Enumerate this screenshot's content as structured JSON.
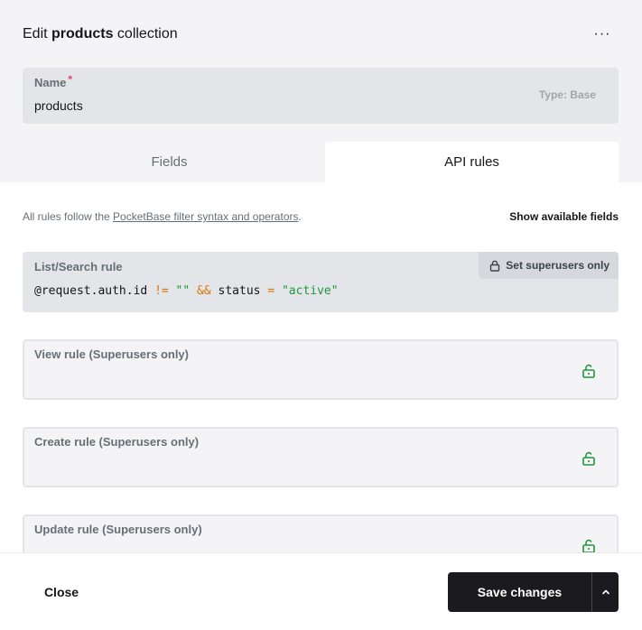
{
  "header": {
    "title_prefix": "Edit ",
    "title_name": "products",
    "title_suffix": " collection",
    "more_icon": "···"
  },
  "name_field": {
    "label": "Name",
    "required_mark": "*",
    "value": "products",
    "type_hint": "Type: Base"
  },
  "tabs": [
    {
      "label": "Fields",
      "active": false
    },
    {
      "label": "API rules",
      "active": true
    }
  ],
  "api_rules": {
    "note_prefix": "All rules follow the ",
    "note_link": "PocketBase filter syntax and operators",
    "note_suffix": ".",
    "show_fields": "Show available fields",
    "list_rule": {
      "label": "List/Search rule",
      "set_superusers_label": "Set superusers only",
      "code": {
        "part1": "@request.auth.id ",
        "op1": "!=",
        "part2": " ",
        "str1": "\"\"",
        "part3": " ",
        "op2": "&&",
        "part4": " status ",
        "op3": "=",
        "part5": " ",
        "str2": "\"active\""
      }
    },
    "view_rule": {
      "label": "View rule",
      "hint": "(Superusers only)"
    },
    "create_rule": {
      "label": "Create rule",
      "hint": "(Superusers only)"
    },
    "update_rule": {
      "label": "Update rule",
      "hint": "(Superusers only)"
    }
  },
  "footer": {
    "close_label": "Close",
    "save_label": "Save changes"
  },
  "colors": {
    "accent_dark": "#1a1a1f",
    "unlock_green": "#21963e",
    "required_red": "#e34562",
    "operator_orange": "#d97706"
  }
}
